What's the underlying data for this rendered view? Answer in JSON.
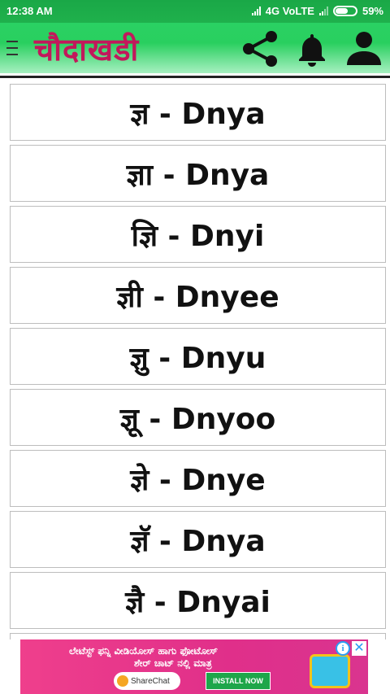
{
  "status_bar": {
    "time": "12:38 AM",
    "network": "4G VoLTE",
    "battery": "59%"
  },
  "app_bar": {
    "title": "चौदाखडी",
    "icons": [
      "menu-icon",
      "share-icon",
      "bell-icon",
      "person-icon"
    ],
    "title_color": "#c2185b",
    "accent_color": "#29cf5f"
  },
  "list": {
    "items": [
      "ज्ञ - Dnya",
      "ज्ञा - Dnya",
      "ज्ञि - Dnyi",
      "ज्ञी - Dnyee",
      "ज्ञु - Dnyu",
      "ज्ञू - Dnyoo",
      "ज्ञे - Dnye",
      "ज्ञॅ - Dnya",
      "ज्ञै - Dnyai"
    ]
  },
  "ad": {
    "line1": "ಲೇಟೆಸ್ಟ್ ಫನ್ನಿ ವೀಡಿಯೋಸ್ ಹಾಗು ಫೋಟೋಸ್",
    "line2": "ಶೇರ್ ಚಾಟ್ ನಲ್ಲಿ ಮಾತ್ರ",
    "brand": "ShareChat",
    "cta": "INSTALL NOW",
    "info_label": "i",
    "close_label": "✕"
  }
}
